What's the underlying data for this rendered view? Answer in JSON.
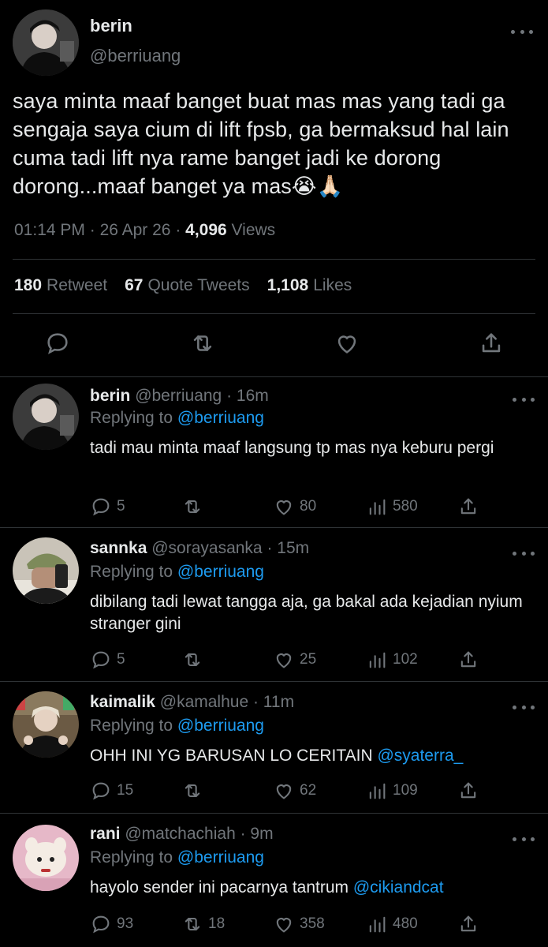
{
  "main_tweet": {
    "display_name": "berin",
    "handle": "@berriuang",
    "text": "saya minta maaf banget buat mas mas yang tadi ga sengaja saya cium di lift fpsb, ga bermaksud hal lain cuma tadi lift nya rame banget jadi ke dorong dorong...maaf banget ya mas😭🙏🏻",
    "time": "01:14 PM",
    "date": "26 Apr 26",
    "views_count": "4,096",
    "views_label": "Views",
    "retweets_count": "180",
    "retweets_label": "Retweet",
    "quotes_count": "67",
    "quotes_label": "Quote Tweets",
    "likes_count": "1,108",
    "likes_label": "Likes"
  },
  "replies": [
    {
      "display_name": "berin",
      "handle": "@berriuang",
      "age": "16m",
      "replying_label": "Replying to",
      "replying_to": "@berriuang",
      "text": "tadi mau minta maaf langsung tp mas nya keburu pergi",
      "mention": "",
      "replies": "5",
      "retweets": "",
      "likes": "80",
      "views": "580"
    },
    {
      "display_name": "sannka",
      "handle": "@sorayasanka",
      "age": "15m",
      "replying_label": "Replying to",
      "replying_to": "@berriuang",
      "text": "dibilang tadi lewat tangga aja, ga bakal ada kejadian nyium stranger gini",
      "mention": "",
      "replies": "5",
      "retweets": "",
      "likes": "25",
      "views": "102"
    },
    {
      "display_name": "kaimalik",
      "handle": "@kamalhue",
      "age": "11m",
      "replying_label": "Replying to",
      "replying_to": "@berriuang",
      "text": "OHH INI YG BARUSAN LO CERITAIN ",
      "mention": "@syaterra_",
      "replies": "15",
      "retweets": "",
      "likes": "62",
      "views": "109"
    },
    {
      "display_name": "rani",
      "handle": "@matchachiah",
      "age": "9m",
      "replying_label": "Replying to",
      "replying_to": "@berriuang",
      "text": "hayolo sender ini pacarnya tantrum ",
      "mention": "@cikiandcat",
      "replies": "93",
      "retweets": "18",
      "likes": "358",
      "views": "480"
    }
  ],
  "colors": {
    "background": "#000000",
    "text": "#e7e9ea",
    "muted": "#71767b",
    "link": "#1d9bf0",
    "divider": "#2f3336"
  }
}
